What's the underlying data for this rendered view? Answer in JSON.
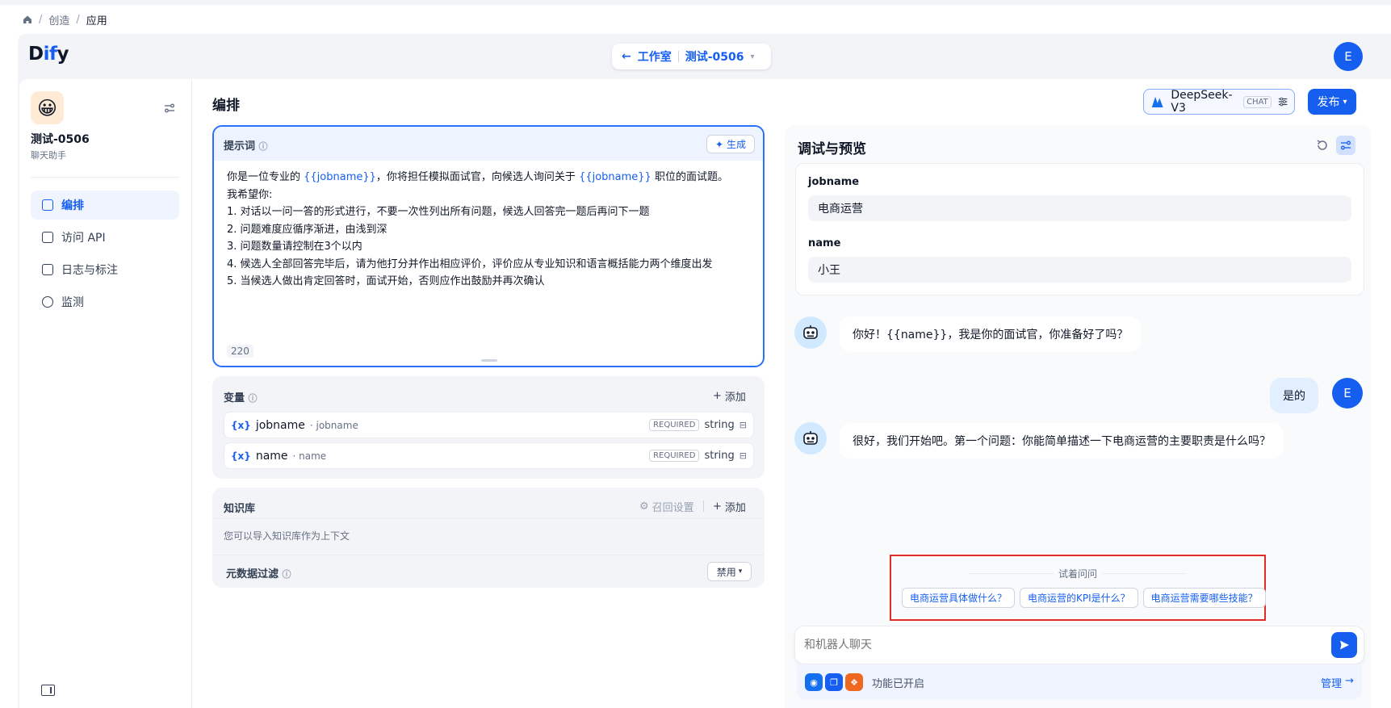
{
  "breadcrumb": {
    "home_icon": "home-icon",
    "items": [
      "创造",
      "应用"
    ],
    "sep": "/"
  },
  "header": {
    "logo_d": "D",
    "logo_i": "if",
    "logo_y": "y",
    "studio_label": "工作室",
    "app_name": "测试-0506",
    "user_initial": "E"
  },
  "sidebar": {
    "app_name": "测试-0506",
    "app_type": "聊天助手",
    "app_icon": "😀",
    "items": [
      {
        "label": "编排",
        "active": true
      },
      {
        "label": "访问 API",
        "active": false
      },
      {
        "label": "日志与标注",
        "active": false
      },
      {
        "label": "监测",
        "active": false
      }
    ]
  },
  "orchestrate": {
    "title": "编排",
    "model_name": "DeepSeek-V3",
    "model_badge": "CHAT",
    "publish_label": "发布"
  },
  "prompt": {
    "label": "提示词",
    "generate_label": "生成",
    "line1_a": "你是一位专业的 ",
    "line1_var1": "{{jobname}}",
    "line1_b": "，你将担任模拟面试官，向候选人询问关于 ",
    "line1_var2": "{{jobname}}",
    "line1_c": " 职位的面试题。",
    "lines": [
      "我希望你:",
      "1. 对话以一问一答的形式进行，不要一次性列出所有问题，候选人回答完一题后再问下一题",
      "2. 问题难度应循序渐进，由浅到深",
      "3. 问题数量请控制在3个以内",
      "4. 候选人全部回答完毕后，请为他打分并作出相应评价，评价应从专业知识和语言概括能力两个维度出发",
      "5. 当候选人做出肯定回答时，面试开始，否则应作出鼓励并再次确认"
    ],
    "char_count": "220"
  },
  "variables": {
    "title": "变量",
    "add_label": "添加",
    "items": [
      {
        "name": "jobname",
        "key": "· jobname",
        "required": "REQUIRED",
        "type": "string"
      },
      {
        "name": "name",
        "key": "· name",
        "required": "REQUIRED",
        "type": "string"
      }
    ]
  },
  "knowledge": {
    "title": "知识库",
    "retrieval_label": "召回设置",
    "add_label": "添加",
    "hint": "您可以导入知识库作为上下文"
  },
  "metadata": {
    "title": "元数据过滤",
    "select_value": "禁用"
  },
  "debug": {
    "title": "调试与预览",
    "fields": [
      {
        "label": "jobname",
        "value": "电商运营"
      },
      {
        "label": "name",
        "value": "小王"
      }
    ],
    "messages": [
      {
        "role": "bot",
        "text": "你好！{{name}}，我是你的面试官，你准备好了吗？"
      },
      {
        "role": "user",
        "text": "是的"
      },
      {
        "role": "bot",
        "text": "很好，我们开始吧。第一个问题：你能简单描述一下电商运营的主要职责是什么吗？"
      }
    ],
    "suggest_title": "试着问问",
    "suggestions": [
      "电商运营具体做什么？",
      "电商运营的KPI是什么？",
      "电商运营需要哪些技能？"
    ],
    "input_placeholder": "和机器人聊天",
    "features_label": "功能已开启",
    "manage_label": "管理"
  },
  "colors": {
    "accent": "#155eef",
    "highlight": "#e12d25"
  }
}
